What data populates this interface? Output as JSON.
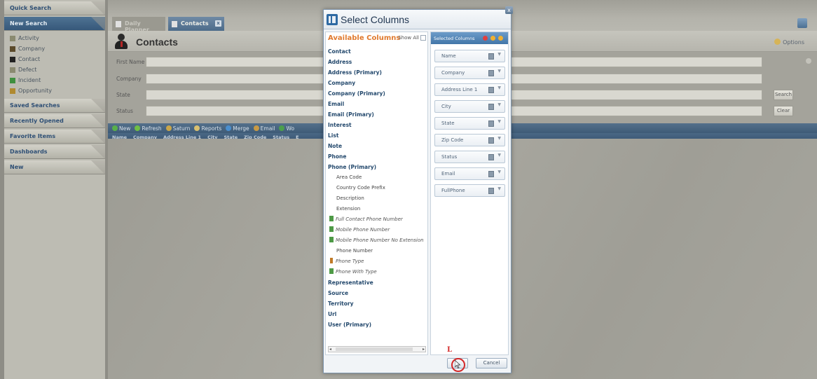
{
  "sidebar": {
    "quick_search": "Quick Search",
    "new_search": "New Search",
    "items": [
      {
        "label": "Activity",
        "icon": "activity-icon",
        "color": "#8a8a70"
      },
      {
        "label": "Company",
        "icon": "company-icon",
        "color": "#5a4a2a"
      },
      {
        "label": "Contact",
        "icon": "contact-icon",
        "color": "#222222"
      },
      {
        "label": "Defect",
        "icon": "defect-icon",
        "color": "#8a8a70"
      },
      {
        "label": "Incident",
        "icon": "incident-icon",
        "color": "#3f8f3f"
      },
      {
        "label": "Opportunity",
        "icon": "opportunity-icon",
        "color": "#b08a30"
      }
    ],
    "sections": [
      "Saved Searches",
      "Recently Opened",
      "Favorite Items",
      "Dashboards",
      "New"
    ]
  },
  "tabs": [
    {
      "label": "Daily Planner",
      "active": false
    },
    {
      "label": "Contacts",
      "active": true,
      "close": "x"
    }
  ],
  "contacts": {
    "title": "Contacts",
    "options_label": "Options",
    "fields": [
      {
        "label": "First Name"
      },
      {
        "label": "Company"
      },
      {
        "label": "State"
      },
      {
        "label": "Status"
      }
    ],
    "search_label": "Search",
    "clear_label": "Clear"
  },
  "toolbar": {
    "items": [
      "New",
      "Refresh",
      "Saturn",
      "Reports",
      "Merge",
      "Email",
      "Wo"
    ]
  },
  "grid_columns": [
    "Name",
    "Company",
    "Address Line 1",
    "City",
    "State",
    "Zip Code",
    "Status",
    "E"
  ],
  "modal": {
    "title": "Select Columns",
    "close": "x",
    "available_title": "Available Columns",
    "show_all_label": "Show All",
    "available_items": [
      {
        "label": "Contact",
        "style": "bold"
      },
      {
        "label": "Address",
        "style": "bold"
      },
      {
        "label": "Address (Primary)",
        "style": "bold"
      },
      {
        "label": "Company",
        "style": "bold"
      },
      {
        "label": "Company (Primary)",
        "style": "bold"
      },
      {
        "label": "Email",
        "style": "bold"
      },
      {
        "label": "Email (Primary)",
        "style": "bold"
      },
      {
        "label": "Interest",
        "style": "bold"
      },
      {
        "label": "List",
        "style": "bold"
      },
      {
        "label": "Note",
        "style": "bold"
      },
      {
        "label": "Phone",
        "style": "bold"
      },
      {
        "label": "Phone (Primary)",
        "style": "bold"
      },
      {
        "label": "Area Code",
        "style": "sub"
      },
      {
        "label": "Country Code Prefix",
        "style": "sub"
      },
      {
        "label": "Description",
        "style": "sub"
      },
      {
        "label": "Extension",
        "style": "sub"
      },
      {
        "label": "Full Contact Phone Number",
        "style": "italic",
        "icon": "phone"
      },
      {
        "label": "Mobile Phone Number",
        "style": "italic",
        "icon": "phone"
      },
      {
        "label": "Mobile Phone Number No Extension",
        "style": "italic",
        "icon": "phone"
      },
      {
        "label": "Phone Number",
        "style": "sub"
      },
      {
        "label": "Phone Type",
        "style": "italic",
        "icon": "type"
      },
      {
        "label": "Phone With Type",
        "style": "italic",
        "icon": "phone"
      },
      {
        "label": "Representative",
        "style": "bold"
      },
      {
        "label": "Source",
        "style": "bold"
      },
      {
        "label": "Territory",
        "style": "bold"
      },
      {
        "label": "Url",
        "style": "bold"
      },
      {
        "label": "User (Primary)",
        "style": "bold"
      }
    ],
    "selected_title": "Selected Columns",
    "selected_items": [
      "Name",
      "Company",
      "Address Line 1",
      "City",
      "State",
      "Zip Code",
      "Status",
      "Email",
      "FullPhone"
    ],
    "cancel_label": "Cancel",
    "annotation_label": "L"
  },
  "colors": {
    "accent": "#4276a8",
    "available_title": "#e07a2e",
    "annotation": "#d42a2a"
  }
}
